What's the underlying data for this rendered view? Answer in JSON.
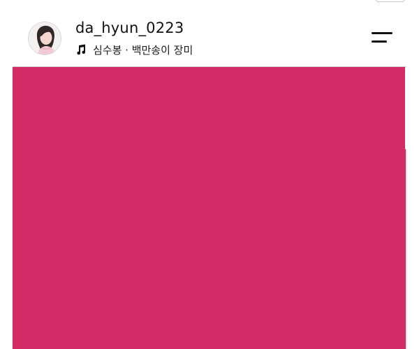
{
  "post": {
    "username": "da_hyun_0223",
    "music": "심수봉 · 백만송이 장미",
    "media_color": "#D22B66"
  },
  "icons": {
    "avatar": "profile-avatar",
    "music": "music-note-icon",
    "menu": "menu-icon"
  },
  "colors": {
    "text": "#111111",
    "media": "#D22B66",
    "divider": "#CFD3D8"
  }
}
